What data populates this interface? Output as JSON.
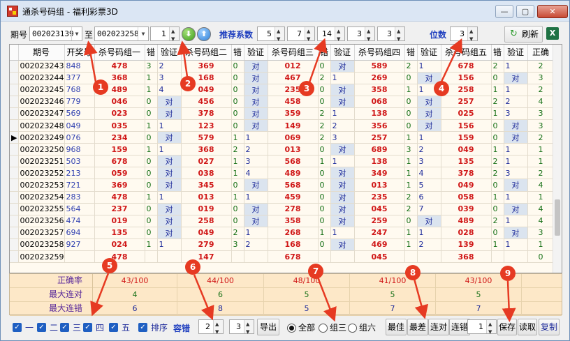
{
  "window": {
    "title": "通杀号码组 - 福利彩票3D",
    "min_label": "—",
    "max_label": "▢",
    "close_label": "✕"
  },
  "toolbar": {
    "period_label": "期号",
    "from_period": "002023139",
    "to_label": "至",
    "to_period": "002023258",
    "step_value": "1",
    "recommend_label": "推荐系数",
    "coef_values": [
      "5",
      "7",
      "14",
      "3",
      "3"
    ],
    "position_label": "位数",
    "position_value": "3",
    "refresh_label": "刷新",
    "down_glyph": "⬇",
    "up_glyph": "⬆",
    "refresh_glyph": "↻",
    "excel_glyph": "X"
  },
  "table": {
    "headers": [
      "期号",
      "开奖号",
      "杀号码组一",
      "错",
      "验证",
      "杀号码组二",
      "错",
      "验证",
      "杀号码组三",
      "错",
      "验证",
      "杀号码组四",
      "错",
      "验证",
      "杀号码组五",
      "错",
      "验证",
      "正确"
    ],
    "rows": [
      [
        "002023243",
        "848",
        "478",
        "3",
        "2",
        "369",
        "0",
        "对",
        "012",
        "0",
        "对",
        "589",
        "2",
        "1",
        "678",
        "2",
        "1",
        "2"
      ],
      [
        "002023244",
        "377",
        "368",
        "1",
        "3",
        "168",
        "0",
        "对",
        "467",
        "2",
        "1",
        "269",
        "0",
        "对",
        "156",
        "0",
        "对",
        "3"
      ],
      [
        "002023245",
        "768",
        "489",
        "1",
        "4",
        "049",
        "0",
        "对",
        "235",
        "0",
        "对",
        "358",
        "1",
        "1",
        "258",
        "1",
        "1",
        "2"
      ],
      [
        "002023246",
        "779",
        "046",
        "0",
        "对",
        "456",
        "0",
        "对",
        "458",
        "0",
        "对",
        "068",
        "0",
        "对",
        "257",
        "2",
        "2",
        "4"
      ],
      [
        "002023247",
        "569",
        "023",
        "0",
        "对",
        "378",
        "0",
        "对",
        "359",
        "2",
        "1",
        "138",
        "0",
        "对",
        "025",
        "1",
        "3",
        "3"
      ],
      [
        "002023248",
        "049",
        "035",
        "1",
        "1",
        "123",
        "0",
        "对",
        "149",
        "2",
        "2",
        "356",
        "0",
        "对",
        "156",
        "0",
        "对",
        "3"
      ],
      [
        "002023249",
        "076",
        "234",
        "0",
        "对",
        "579",
        "1",
        "1",
        "069",
        "2",
        "3",
        "257",
        "1",
        "1",
        "159",
        "0",
        "对",
        "2"
      ],
      [
        "002023250",
        "968",
        "159",
        "1",
        "1",
        "368",
        "2",
        "2",
        "013",
        "0",
        "对",
        "689",
        "3",
        "2",
        "049",
        "1",
        "1",
        "1"
      ],
      [
        "002023251",
        "503",
        "678",
        "0",
        "对",
        "027",
        "1",
        "3",
        "568",
        "1",
        "1",
        "138",
        "1",
        "3",
        "135",
        "2",
        "1",
        "1"
      ],
      [
        "002023252",
        "213",
        "059",
        "0",
        "对",
        "038",
        "1",
        "4",
        "489",
        "0",
        "对",
        "349",
        "1",
        "4",
        "378",
        "2",
        "3",
        "2"
      ],
      [
        "002023253",
        "721",
        "369",
        "0",
        "对",
        "345",
        "0",
        "对",
        "568",
        "0",
        "对",
        "013",
        "1",
        "5",
        "049",
        "0",
        "对",
        "4"
      ],
      [
        "002023254",
        "283",
        "478",
        "1",
        "1",
        "013",
        "1",
        "1",
        "459",
        "0",
        "对",
        "235",
        "2",
        "6",
        "058",
        "1",
        "1",
        "1"
      ],
      [
        "002023255",
        "564",
        "237",
        "0",
        "对",
        "019",
        "0",
        "对",
        "278",
        "0",
        "对",
        "045",
        "2",
        "7",
        "039",
        "0",
        "对",
        "4"
      ],
      [
        "002023256",
        "474",
        "019",
        "0",
        "对",
        "258",
        "0",
        "对",
        "358",
        "0",
        "对",
        "259",
        "0",
        "对",
        "489",
        "2",
        "1",
        "4"
      ],
      [
        "002023257",
        "694",
        "135",
        "0",
        "对",
        "049",
        "2",
        "1",
        "268",
        "1",
        "1",
        "247",
        "1",
        "1",
        "028",
        "0",
        "对",
        "3"
      ],
      [
        "002023258",
        "927",
        "024",
        "1",
        "1",
        "279",
        "3",
        "2",
        "168",
        "0",
        "对",
        "469",
        "1",
        "2",
        "139",
        "1",
        "1",
        "1"
      ],
      [
        "002023259",
        "",
        "478",
        "",
        "",
        "147",
        "",
        "",
        "678",
        "",
        "",
        "045",
        "",
        "",
        "368",
        "",
        "",
        "0"
      ]
    ],
    "selected_row": 6,
    "indicator_glyph": "▶"
  },
  "stats": {
    "labels": [
      "正确率",
      "最大连对",
      "最大连错"
    ],
    "values": [
      [
        "43/100",
        "44/100",
        "48/100",
        "41/100",
        "43/100"
      ],
      [
        "4",
        "6",
        "5",
        "5",
        "5"
      ],
      [
        "6",
        "8",
        "5",
        "7",
        "7"
      ]
    ]
  },
  "bottom": {
    "groups": [
      "一",
      "二",
      "三",
      "四",
      "五"
    ],
    "sort_label": "排序",
    "tolerance_label": "容错",
    "tolerance_min": "2",
    "tolerance_max": "3",
    "export_label": "导出",
    "radio_all": "全部",
    "radio_three": "组三",
    "radio_six": "组六",
    "best_label": "最佳",
    "worst_label": "最差",
    "consec_right_label": "连对",
    "consec_wrong_label": "连错",
    "consec_value": "1",
    "save_label": "保存",
    "read_label": "读取",
    "copy_label": "复制"
  },
  "annotations": [
    "1",
    "2",
    "3",
    "4",
    "5",
    "6",
    "7",
    "8",
    "9"
  ],
  "colors": {
    "kill_number": "#d01818",
    "correct_mark_bg": "#dbe4ef",
    "stats_bg": "#fde8c8",
    "marker": "#e63a22"
  }
}
